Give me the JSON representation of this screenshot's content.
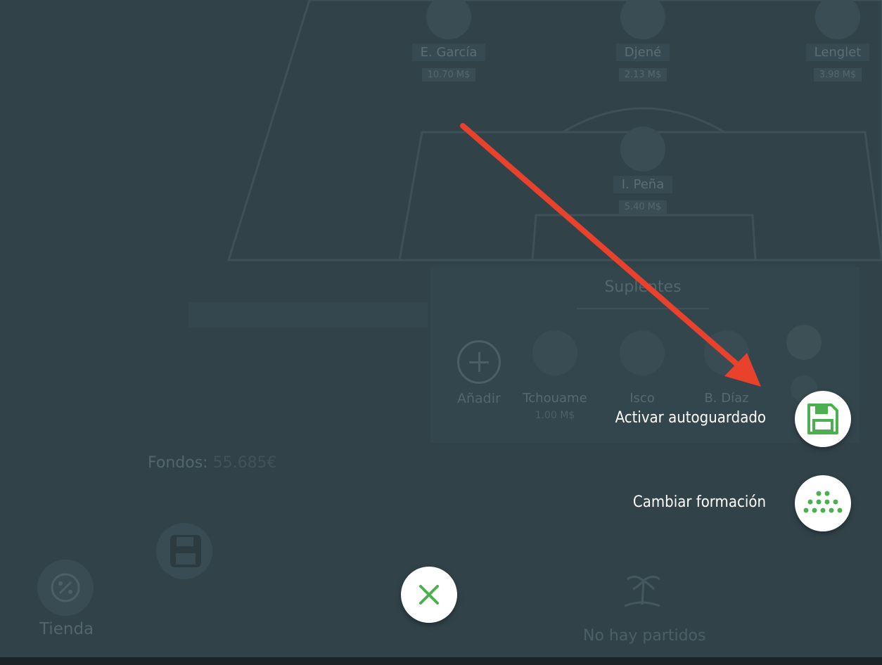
{
  "lineup": {
    "players": [
      {
        "name": "E. García",
        "price": "10.70 M$"
      },
      {
        "name": "Djené",
        "price": "2.13 M$"
      },
      {
        "name": "Lenglet",
        "price": "3.98 M$"
      },
      {
        "name": "I. Peña",
        "price": "5.40 M$"
      }
    ]
  },
  "bench": {
    "title": "Suplentes",
    "add_label": "Añadir",
    "players": [
      {
        "name": "Tchouame",
        "price": "1.00 M$"
      },
      {
        "name": "Isco",
        "price": ""
      },
      {
        "name": "B. Díaz",
        "price": ""
      }
    ]
  },
  "funds": {
    "label": "Fondos:",
    "value": "55.685€"
  },
  "shop": {
    "label": "Tienda"
  },
  "matches": {
    "empty_label": "No hay partidos"
  },
  "menu": {
    "autosave_label": "Activar autoguardado",
    "formation_label": "Cambiar formación",
    "autosave_icon": "floppy-disk-icon",
    "formation_icon": "formation-dots-icon",
    "close_icon": "close-icon"
  },
  "colors": {
    "accent": "#4caf50",
    "arrow": "#e8412c",
    "overlay": "#314349"
  }
}
